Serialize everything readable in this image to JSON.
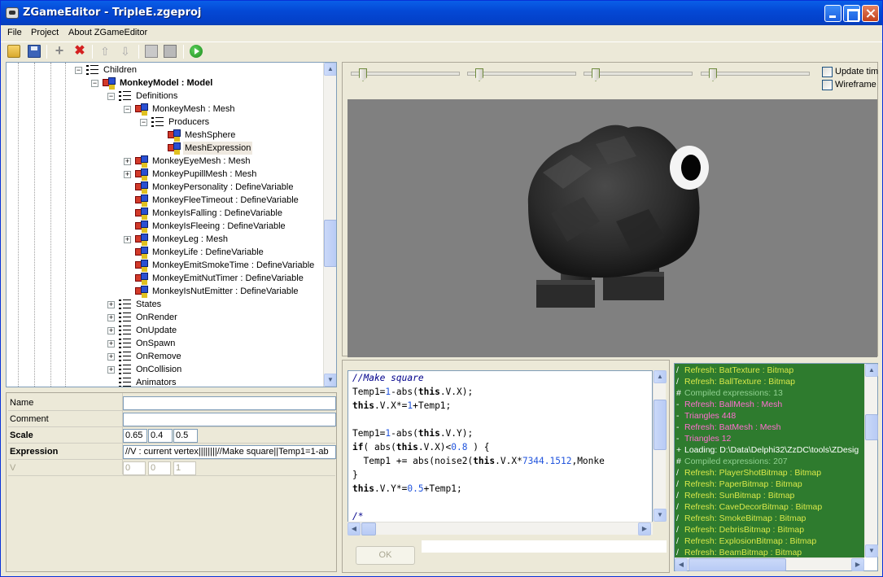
{
  "window": {
    "title": "ZGameEditor - TripleE.zgeproj"
  },
  "menu": [
    "File",
    "Project",
    "About ZGameEditor"
  ],
  "tree": {
    "nodes": [
      {
        "label": "Children",
        "expander": "−",
        "icon": "list"
      },
      {
        "label": "MonkeyModel : Model",
        "expander": "−",
        "icon": "component",
        "bold": true
      },
      {
        "label": "Definitions",
        "expander": "−",
        "icon": "list"
      },
      {
        "label": "MonkeyMesh : Mesh",
        "expander": "−",
        "icon": "component"
      },
      {
        "label": "Producers",
        "expander": "−",
        "icon": "list"
      },
      {
        "label": "MeshSphere",
        "expander": "",
        "icon": "component"
      },
      {
        "label": "MeshExpression",
        "expander": "",
        "icon": "component",
        "selected": true
      },
      {
        "label": "MonkeyEyeMesh : Mesh",
        "expander": "+",
        "icon": "component"
      },
      {
        "label": "MonkeyPupillMesh : Mesh",
        "expander": "+",
        "icon": "component"
      },
      {
        "label": "MonkeyPersonality : DefineVariable",
        "expander": "",
        "icon": "component"
      },
      {
        "label": "MonkeyFleeTimeout : DefineVariable",
        "expander": "",
        "icon": "component"
      },
      {
        "label": "MonkeyIsFalling : DefineVariable",
        "expander": "",
        "icon": "component"
      },
      {
        "label": "MonkeyIsFleeing : DefineVariable",
        "expander": "",
        "icon": "component"
      },
      {
        "label": "MonkeyLeg : Mesh",
        "expander": "+",
        "icon": "component"
      },
      {
        "label": "MonkeyLife : DefineVariable",
        "expander": "",
        "icon": "component"
      },
      {
        "label": "MonkeyEmitSmokeTime : DefineVariable",
        "expander": "",
        "icon": "component"
      },
      {
        "label": "MonkeyEmitNutTimer : DefineVariable",
        "expander": "",
        "icon": "component"
      },
      {
        "label": "MonkeyIsNutEmitter : DefineVariable",
        "expander": "",
        "icon": "component"
      },
      {
        "label": "States",
        "expander": "+",
        "icon": "list"
      },
      {
        "label": "OnRender",
        "expander": "+",
        "icon": "list"
      },
      {
        "label": "OnUpdate",
        "expander": "+",
        "icon": "list"
      },
      {
        "label": "OnSpawn",
        "expander": "+",
        "icon": "list"
      },
      {
        "label": "OnRemove",
        "expander": "+",
        "icon": "list"
      },
      {
        "label": "OnCollision",
        "expander": "+",
        "icon": "list"
      },
      {
        "label": "Animators",
        "expander": "",
        "icon": "list"
      }
    ]
  },
  "properties": {
    "name": {
      "label": "Name",
      "value": ""
    },
    "comment": {
      "label": "Comment",
      "value": ""
    },
    "scale": {
      "label": "Scale",
      "x": "0.65",
      "y": "0.4",
      "z": "0.5"
    },
    "expression": {
      "label": "Expression",
      "value": "//V : current vertex||||||||//Make square||Temp1=1-ab"
    },
    "v": {
      "label": "V",
      "x": "0",
      "y": "0",
      "z": "1"
    }
  },
  "preview": {
    "slider_positions": [
      0,
      0,
      0,
      0
    ],
    "update_time_label": "Update tim",
    "wireframe_label": "Wireframe"
  },
  "editor": {
    "ok_label": "OK",
    "lines": [
      "//Make square",
      "Temp1=1-abs(this.V.X);",
      "this.V.X*=1+Temp1;",
      "",
      "Temp1=1-abs(this.V.Y);",
      "if( abs(this.V.X)<0.8 ) {",
      "  Temp1 += abs(noise2(this.V.X*7344.1512,Monke",
      "}",
      "this.V.Y*=0.5+Temp1;",
      "",
      "/*"
    ]
  },
  "log": {
    "colors": {
      "refresh": "#d8e84a",
      "compiled": "#8fd08f",
      "mesh": "#ff6fd0",
      "loading": "#ffffff",
      "background": "#2e7b2e"
    },
    "lines": [
      {
        "prefix": "/",
        "text": "Refresh: BatTexture : Bitmap",
        "kind": "refresh"
      },
      {
        "prefix": "/",
        "text": "Refresh: BallTexture : Bitmap",
        "kind": "refresh"
      },
      {
        "prefix": "#",
        "text": "Compiled expressions: 13",
        "kind": "compiled"
      },
      {
        "prefix": "-",
        "text": "Refresh: BallMesh : Mesh",
        "kind": "mesh"
      },
      {
        "prefix": "-",
        "text": "Triangles 448",
        "kind": "mesh"
      },
      {
        "prefix": "-",
        "text": "Refresh: BatMesh : Mesh",
        "kind": "mesh"
      },
      {
        "prefix": "-",
        "text": "Triangles 12",
        "kind": "mesh"
      },
      {
        "prefix": "+",
        "text": "Loading: D:\\Data\\Delphi32\\ZzDC\\tools\\ZDesig",
        "kind": "loading"
      },
      {
        "prefix": "#",
        "text": "Compiled expressions: 207",
        "kind": "compiled"
      },
      {
        "prefix": "/",
        "text": "Refresh: PlayerShotBitmap : Bitmap",
        "kind": "refresh"
      },
      {
        "prefix": "/",
        "text": "Refresh: PaperBitmap : Bitmap",
        "kind": "refresh"
      },
      {
        "prefix": "/",
        "text": "Refresh: SunBitmap : Bitmap",
        "kind": "refresh"
      },
      {
        "prefix": "/",
        "text": "Refresh: CaveDecorBitmap : Bitmap",
        "kind": "refresh"
      },
      {
        "prefix": "/",
        "text": "Refresh: SmokeBitmap : Bitmap",
        "kind": "refresh"
      },
      {
        "prefix": "/",
        "text": "Refresh: DebrisBitmap : Bitmap",
        "kind": "refresh"
      },
      {
        "prefix": "/",
        "text": "Refresh: ExplosionBitmap : Bitmap",
        "kind": "refresh"
      },
      {
        "prefix": "/",
        "text": "Refresh: BeamBitmap : Bitmap",
        "kind": "refresh"
      }
    ]
  }
}
